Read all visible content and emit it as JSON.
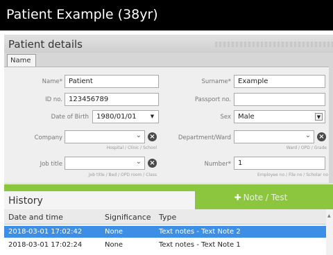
{
  "window": {
    "title": "Patient Example (38yr)"
  },
  "panel": {
    "title": "Patient details",
    "tab": "Name"
  },
  "form": {
    "name": {
      "label": "Name*",
      "value": "Patient"
    },
    "surname": {
      "label": "Surname*",
      "value": "Example"
    },
    "id_no": {
      "label": "ID no.",
      "value": "123456789"
    },
    "passport": {
      "label": "Passport no.",
      "value": ""
    },
    "dob": {
      "label": "Date of Birth",
      "value": "1980/01/01"
    },
    "sex": {
      "label": "Sex",
      "value": "Male"
    },
    "company": {
      "label": "Company",
      "value": "",
      "hint": "Hospital / Clinic / School"
    },
    "department": {
      "label": "Department/Ward",
      "value": "",
      "hint": "Ward / OPD / Grade"
    },
    "job_title": {
      "label": "Job title",
      "value": "",
      "hint": "Job title / Bed / OPD room / Class"
    },
    "number": {
      "label": "Number*",
      "value": "1",
      "hint": "Employee no / File no / Scholar no"
    }
  },
  "history": {
    "title": "History",
    "add_button": "Note / Test",
    "columns": [
      "Date and time",
      "Significance",
      "Type"
    ],
    "rows": [
      {
        "datetime": "2018-03-01 17:02:42",
        "significance": "None",
        "type": "Text notes - Text Note 2",
        "selected": true
      },
      {
        "datetime": "2018-03-01 17:02:24",
        "significance": "None",
        "type": "Text notes - Text Note 1",
        "selected": false
      }
    ]
  },
  "colors": {
    "accent": "#8cc63e",
    "selection": "#3d8fe6",
    "titlebar": "#000000"
  }
}
